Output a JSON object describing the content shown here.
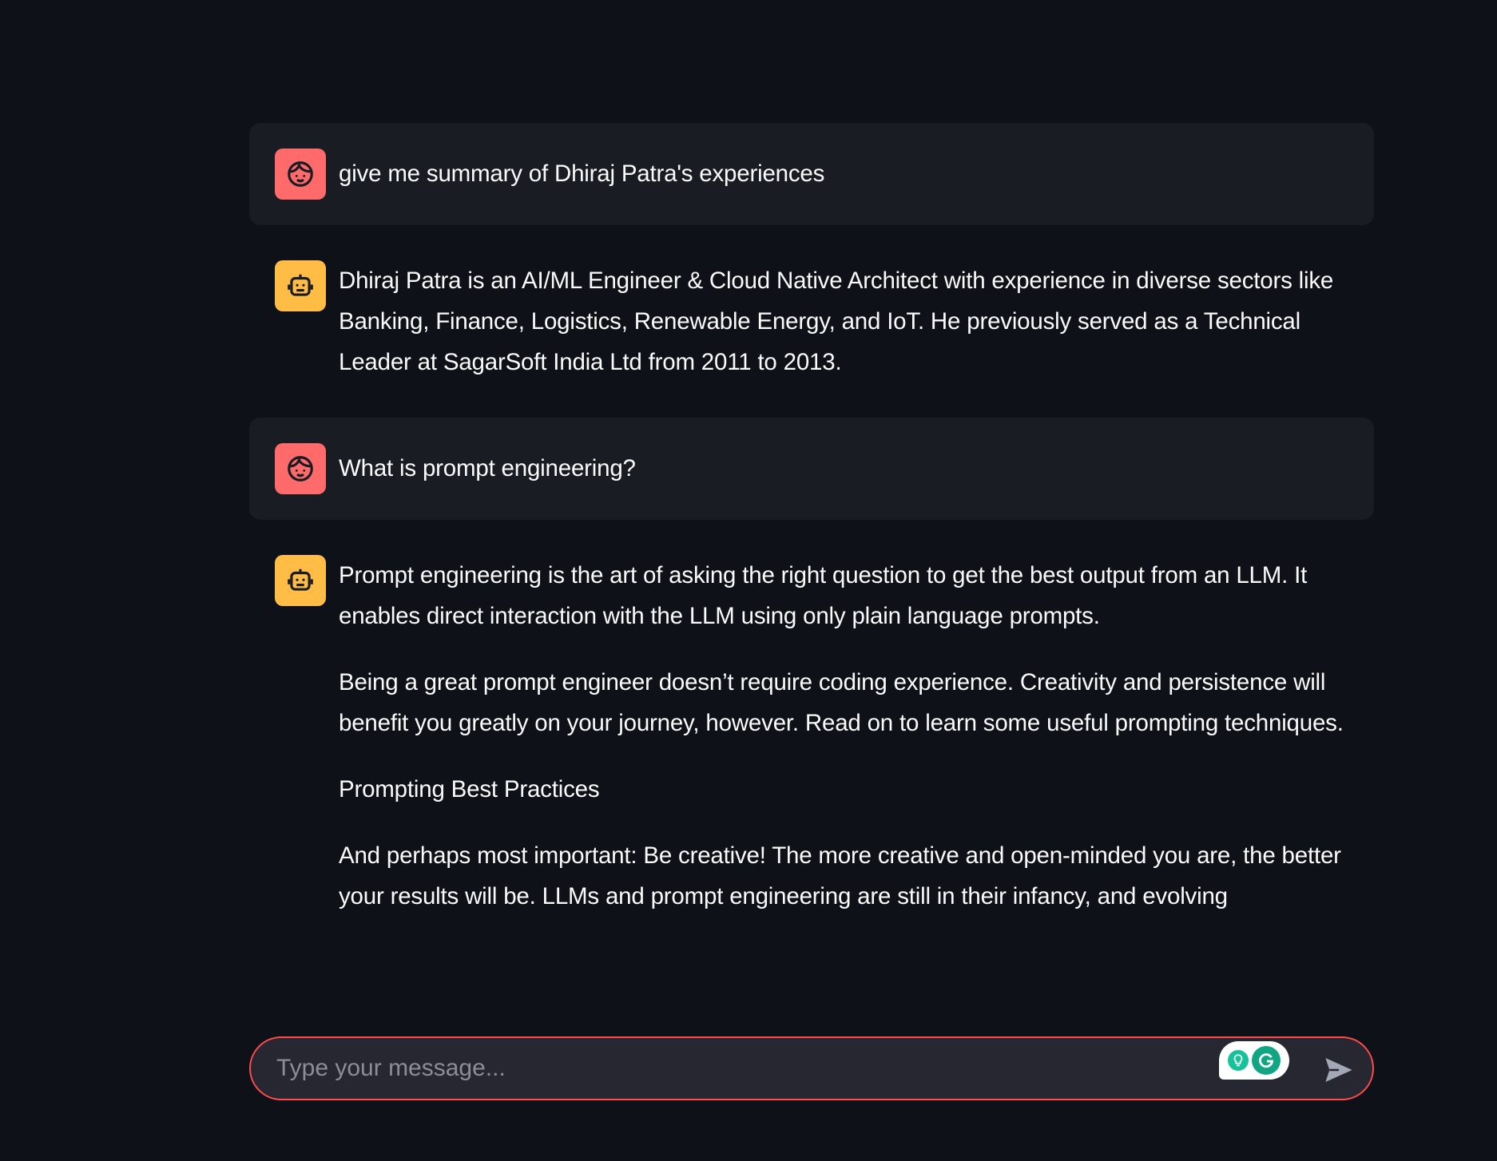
{
  "messages": [
    {
      "role": "user",
      "avatar_icon": "user-face-icon",
      "paragraphs": [
        "give me summary of Dhiraj Patra's experiences"
      ]
    },
    {
      "role": "assistant",
      "avatar_icon": "robot-icon",
      "paragraphs": [
        "Dhiraj Patra is an AI/ML Engineer & Cloud Native Architect with experience in diverse sectors like Banking, Finance, Logistics, Renewable Energy, and IoT. He previously served as a Technical Leader at SagarSoft India Ltd from 2011 to 2013."
      ]
    },
    {
      "role": "user",
      "avatar_icon": "user-face-icon",
      "paragraphs": [
        "What is prompt engineering?"
      ]
    },
    {
      "role": "assistant",
      "avatar_icon": "robot-icon",
      "paragraphs": [
        "Prompt engineering is the art of asking the right question to get the best output from an LLM. It enables direct interaction with the LLM using only plain language prompts.",
        "Being a great prompt engineer doesn’t require coding experience. Creativity and persistence will benefit you greatly on your journey, however. Read on to learn some useful prompting techniques.",
        "Prompting Best Practices",
        "And perhaps most important: Be creative! The more creative and open-minded you are, the better your results will be. LLMs and prompt engineering are still in their infancy, and evolving"
      ]
    }
  ],
  "chat_input": {
    "placeholder": "Type your message...",
    "value": ""
  },
  "colors": {
    "background": "#0e1117",
    "user_bubble": "#1a1c24",
    "user_avatar": "#ff6b6b",
    "assistant_avatar": "#ffbd45",
    "input_border": "#ff4b4b"
  }
}
